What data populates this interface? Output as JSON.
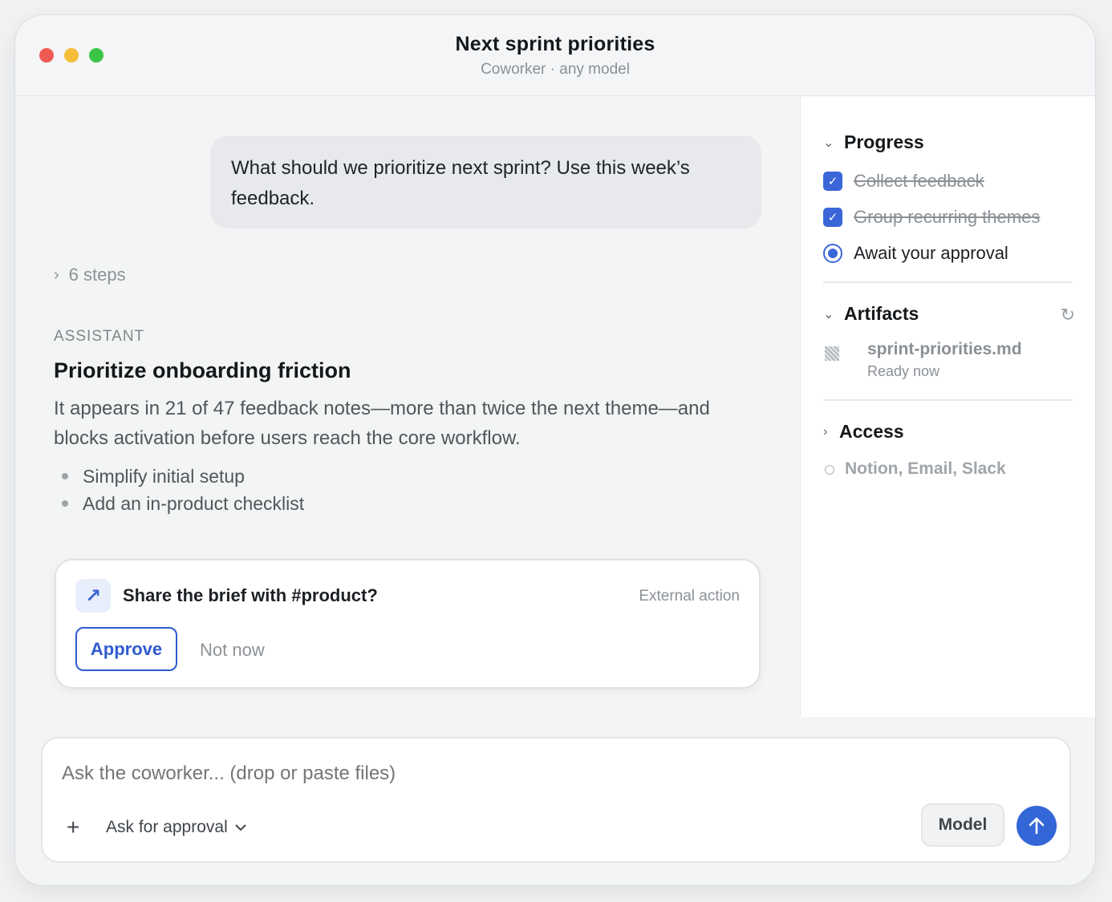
{
  "window": {
    "title": "Next sprint priorities",
    "subtitle": "Coworker · any model"
  },
  "conversation": {
    "user_message": "What should we prioritize next sprint? Use this week’s feedback.",
    "steps_label": "6 steps",
    "role_label": "ASSISTANT",
    "headline": "Prioritize onboarding friction",
    "body": "It appears in 21 of 47 feedback notes—more than twice the next theme—and blocks activation before users reach the core workflow.",
    "bullets": [
      "Simplify initial setup",
      "Add an in-product checklist"
    ]
  },
  "approval_card": {
    "icon": "arrow-up-right-icon",
    "question": "Share the brief with #product?",
    "tag": "External action",
    "approve_label": "Approve",
    "decline_label": "Not now"
  },
  "sidebar": {
    "progress": {
      "label": "Progress",
      "tasks": [
        {
          "label": "Collect feedback",
          "status": "done"
        },
        {
          "label": "Group recurring themes",
          "status": "done"
        },
        {
          "label": "Await your approval",
          "status": "active"
        }
      ]
    },
    "artifacts": {
      "label": "Artifacts",
      "file_name": "sprint-priorities.md",
      "file_status": "Ready now"
    },
    "access": {
      "label": "Access",
      "services": "Notion, Email, Slack"
    }
  },
  "composer": {
    "placeholder": "Ask the coworker... (drop or paste files)",
    "mode_label": "Ask for approval",
    "model_label": "Model"
  },
  "colors": {
    "accent": "#3366d6",
    "close": "#ee5a52",
    "minimize": "#f6bd3b",
    "maximize": "#3cc444"
  }
}
